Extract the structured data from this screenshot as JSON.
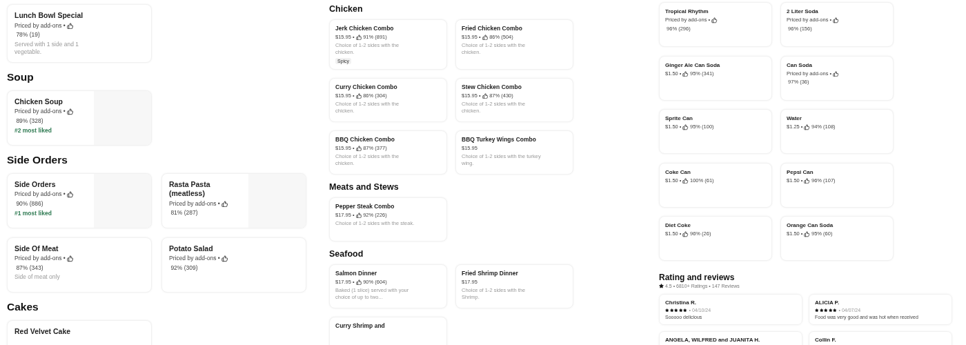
{
  "panels": [
    {
      "sections": [
        {
          "items": [
            {
              "kind": "addons",
              "name": "Lunch  Bowl Special",
              "price": "Priced by add-ons •",
              "rating": "78% (19)",
              "description": "Served with 1 side and 1 vegetable."
            }
          ]
        },
        {
          "heading": "Soup",
          "items": [
            {
              "kind": "addons",
              "name": "Chicken Soup",
              "price": "Priced by add-ons •",
              "rating": "89% (328)",
              "highlight": "#2 most liked",
              "has_image": true
            }
          ]
        },
        {
          "heading": "Side Orders",
          "items": [
            {
              "kind": "addons",
              "name": "Side Orders",
              "price": "Priced by add-ons •",
              "rating": "90% (886)",
              "highlight": "#1 most liked",
              "has_image": true
            },
            {
              "kind": "addons",
              "name": "Rasta Pasta (meatless)",
              "price": "Priced by add-ons •",
              "rating": "81% (287)",
              "has_image": true
            },
            {
              "kind": "addons",
              "name": "Side Of Meat",
              "price": "Priced by add-ons •",
              "rating": "87% (343)",
              "description": "Side of meat only"
            },
            {
              "kind": "addons",
              "name": "Potato Salad",
              "price": "Priced by add-ons •",
              "rating": "92% (309)"
            }
          ]
        },
        {
          "heading": "Cakes",
          "items": [
            {
              "kind": "fixed",
              "name": "Red Velvet Cake"
            }
          ]
        }
      ]
    },
    {
      "sections": [
        {
          "heading": "Chicken",
          "items": [
            {
              "kind": "fixed",
              "name": "Jerk Chicken Combo",
              "price": "$15.95 •",
              "rating": "91% (891)",
              "description": "Choice of 1-2 sides with the chicken.",
              "tag": "Spicy"
            },
            {
              "kind": "fixed",
              "name": "Fried Chicken Combo",
              "price": "$15.95 •",
              "rating": "86% (504)",
              "description": "Choice of 1-2 sides with the chicken."
            },
            {
              "kind": "fixed",
              "name": "Curry Chicken Combo",
              "price": "$15.95 •",
              "rating": "86% (304)",
              "description": "Choice of 1-2 sides with the chicken."
            },
            {
              "kind": "fixed",
              "name": "Stew Chicken Combo",
              "price": "$15.95 •",
              "rating": "87% (430)",
              "description": "Choice of 1-2 sides with the chicken."
            },
            {
              "kind": "fixed",
              "name": "BBQ Chicken Combo",
              "price": "$15.95 •",
              "rating": "87% (377)",
              "description": "Choice of 1-2 sides with the chicken."
            },
            {
              "kind": "fixed",
              "name": "BBQ Turkey Wings Combo",
              "price": "$15.95",
              "description": "Choice of 1-2 sides with the turkey wing."
            }
          ]
        },
        {
          "heading": "Meats and Stews",
          "items": [
            {
              "kind": "fixed",
              "name": "Pepper Steak Combo",
              "price": "$17.95 •",
              "rating": "92% (226)",
              "description": "Choice of 1-2 sides with the steak."
            }
          ]
        },
        {
          "heading": "Seafood",
          "items": [
            {
              "kind": "fixed",
              "name": "Salmon Dinner",
              "price": "$17.95 •",
              "rating": "90% (604)",
              "description": "Baked (1 slice) served with your choice of up to two..."
            },
            {
              "kind": "fixed",
              "name": "Fried Shrimp Dinner",
              "price": "$17.95",
              "description": "Choice of 1-2 sides with the Shrimp."
            },
            {
              "kind": "fixed",
              "name": "Curry Shrimp and"
            }
          ]
        }
      ]
    },
    {
      "sections": [
        {
          "items": [
            {
              "kind": "addons",
              "name": "Tropical Rhythm",
              "price": "Priced by add-ons •",
              "rating": "96% (296)"
            },
            {
              "kind": "addons",
              "name": "2 Liter Soda",
              "price": "Priced by add-ons •",
              "rating": "96% (156)"
            },
            {
              "kind": "fixed",
              "name": "Ginger Ale Can Soda",
              "price": "$1.50 •",
              "rating": "95% (341)"
            },
            {
              "kind": "addons",
              "name": "Can Soda",
              "price": "Priced by add-ons •",
              "rating": "97% (36)"
            },
            {
              "kind": "fixed",
              "name": "Sprite Can",
              "price": "$1.50 •",
              "rating": "95% (100)"
            },
            {
              "kind": "fixed",
              "name": "Water",
              "price": "$1.25 •",
              "rating": "94% (108)"
            },
            {
              "kind": "fixed",
              "name": "Coke Can",
              "price": "$1.50 •",
              "rating": "100% (61)"
            },
            {
              "kind": "fixed",
              "name": "Pepsi Can",
              "price": "$1.50 •",
              "rating": "96% (107)"
            },
            {
              "kind": "fixed",
              "name": "Diet Coke",
              "price": "$1.50 •",
              "rating": "96% (26)"
            },
            {
              "kind": "fixed",
              "name": "Orange  Can Soda",
              "price": "$1.50 •",
              "rating": "95% (60)"
            }
          ]
        },
        {
          "heading": "Rating and reviews",
          "summary": "4.5 • 6810+ Ratings • 147 Reviews",
          "reviews": [
            {
              "name": "Christina R.",
              "stars": 5,
              "date": "• 04/10/24",
              "text": "Sooooo delicious"
            },
            {
              "name": "ALICIA P.",
              "stars": 5,
              "date": "• 04/07/24",
              "text": "Food was very good and was hot when received"
            },
            {
              "name": "ANGELA, WILFRED and JUANITA H."
            },
            {
              "name": "Collin F."
            }
          ]
        }
      ]
    }
  ]
}
